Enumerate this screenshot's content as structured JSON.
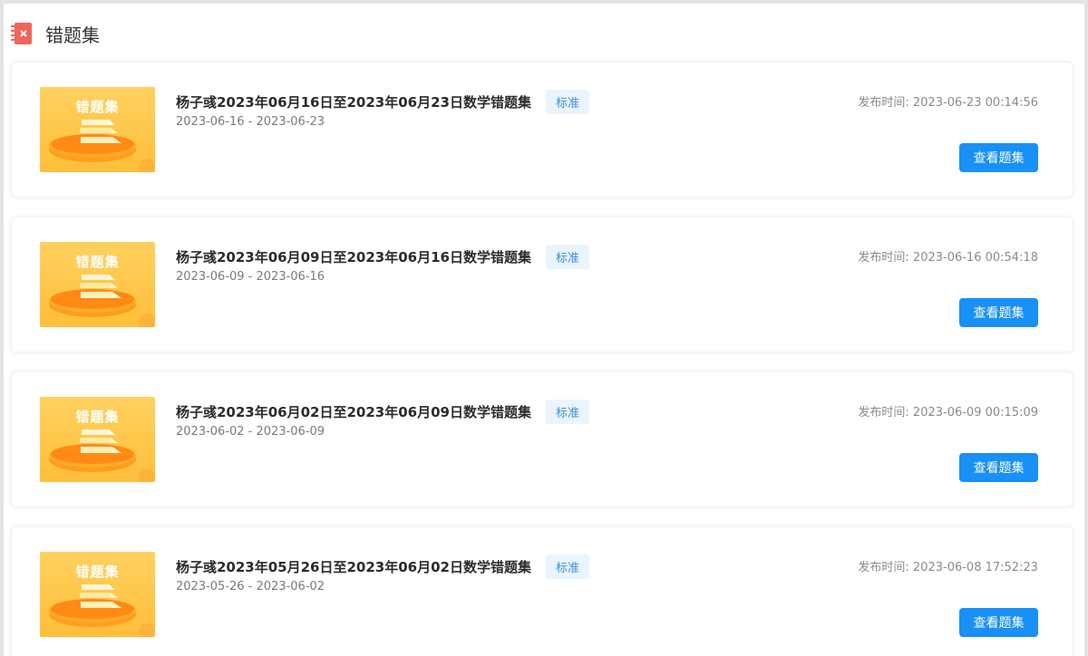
{
  "header": {
    "title": "错题集",
    "icon": "notebook-icon"
  },
  "thumbnail_label": "错题集",
  "view_button_label": "查看题集",
  "tag_label": "标准",
  "publish_prefix": "发布时间:",
  "colors": {
    "accent_blue": "#1890f5",
    "tag_text": "#3b8fd5",
    "tag_bg": "#eaf4fd",
    "thumb_orange": "#ffbe3a",
    "header_icon_red": "#f0645a"
  },
  "items": [
    {
      "title": "杨子彧2023年06月16日至2023年06月23日数学错题集",
      "range": "2023-06-16 - 2023-06-23",
      "published": "2023-06-23 00:14:56"
    },
    {
      "title": "杨子彧2023年06月09日至2023年06月16日数学错题集",
      "range": "2023-06-09 - 2023-06-16",
      "published": "2023-06-16 00:54:18"
    },
    {
      "title": "杨子彧2023年06月02日至2023年06月09日数学错题集",
      "range": "2023-06-02 - 2023-06-09",
      "published": "2023-06-09 00:15:09"
    },
    {
      "title": "杨子彧2023年05月26日至2023年06月02日数学错题集",
      "range": "2023-05-26 - 2023-06-02",
      "published": "2023-06-08 17:52:23"
    }
  ]
}
